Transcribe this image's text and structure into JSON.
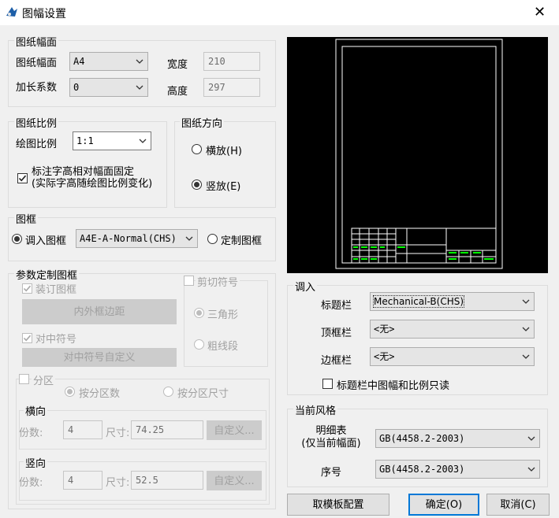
{
  "window": {
    "title": "图幅设置",
    "close_glyph": "✕"
  },
  "paper_size": {
    "group_title": "图纸幅面",
    "size_label": "图纸幅面",
    "size_value": "A4",
    "extension_label": "加长系数",
    "extension_value": "0",
    "width_label": "宽度",
    "width_value": "210",
    "height_label": "高度",
    "height_value": "297"
  },
  "scale": {
    "group_title": "图纸比例",
    "scale_label": "绘图比例",
    "scale_value": "1:1",
    "fixed_text_label_line1": "标注字高相对幅面固定",
    "fixed_text_label_line2": "(实际字高随绘图比例变化)",
    "fixed_text_checked": true
  },
  "orientation": {
    "group_title": "图纸方向",
    "landscape_label": "横放(H)",
    "portrait_label": "竖放(E)",
    "selected": "portrait"
  },
  "frame": {
    "group_title": "图框",
    "load_label": "调入图框",
    "load_value": "A4E-A-Normal(CHS)",
    "custom_label": "定制图框",
    "selected": "load"
  },
  "param_frame": {
    "group_title": "参数定制图框",
    "binding_label": "装订图框",
    "inner_outer_button": "内外框边距",
    "center_mark_label": "对中符号",
    "center_custom_button": "对中符号自定义",
    "cut_mark_label": "剪切符号",
    "triangle_label": "三角形",
    "thick_line_label": "粗线段",
    "zone_label": "分区",
    "by_count_label": "按分区数",
    "by_size_label": "按分区尺寸",
    "horizontal": {
      "title": "横向",
      "count_label": "份数:",
      "count_value": "4",
      "size_label": "尺寸:",
      "size_value": "74.25",
      "custom_button": "自定义..."
    },
    "vertical": {
      "title": "竖向",
      "count_label": "份数:",
      "count_value": "4",
      "size_label": "尺寸:",
      "size_value": "52.5",
      "custom_button": "自定义..."
    }
  },
  "import": {
    "group_title": "调入",
    "title_block_label": "标题栏",
    "title_block_value": "Mechanical-B(CHS)",
    "top_frame_label": "顶框栏",
    "top_frame_value": "<无>",
    "side_frame_label": "边框栏",
    "side_frame_value": "<无>",
    "readonly_label": "标题栏中图幅和比例只读",
    "readonly_checked": false
  },
  "style": {
    "group_title": "当前风格",
    "detail_label_line1": "明细表",
    "detail_label_line2": "(仅当前幅面)",
    "detail_value": "GB(4458.2-2003)",
    "serial_label": "序号",
    "serial_value": "GB(4458.2-2003)"
  },
  "buttons": {
    "template": "取模板配置",
    "ok": "确定(O)",
    "cancel": "取消(C)"
  },
  "colors": {
    "preview_bg": "#000000",
    "frame_line": "#ffffff",
    "title_block_accent": "#00ff00",
    "default_button_border": "#0078d7"
  }
}
